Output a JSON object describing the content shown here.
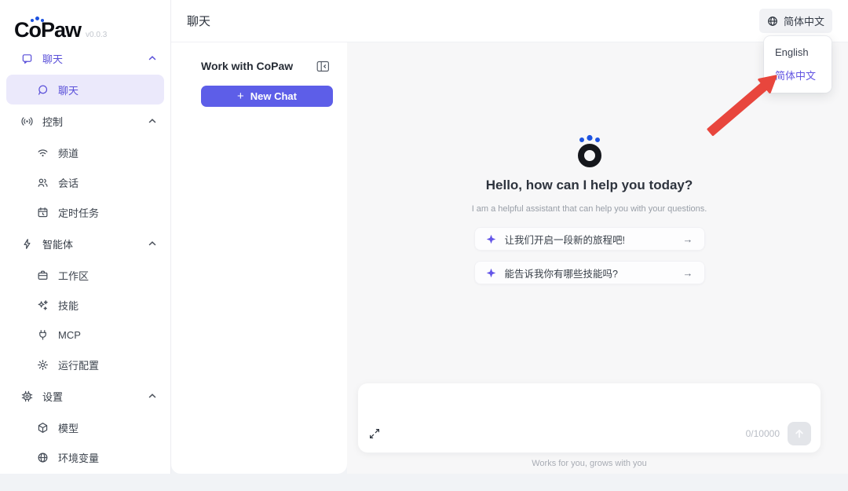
{
  "app": {
    "name": "CoPaw",
    "version": "v0.0.3"
  },
  "colors": {
    "accent": "#5d5ee8",
    "active_item_bg": "#ebe9fb",
    "logo_dot_blue": "#1d53e0",
    "annotation_arrow_red": "#e8463d"
  },
  "icons": {
    "plus": "+",
    "arrow_right": "→"
  },
  "sidebar": {
    "items": [
      {
        "label": "聊天",
        "type": "section",
        "icon": "chat-square"
      },
      {
        "label": "聊天",
        "type": "sub",
        "icon": "chat-bubble",
        "active": true
      },
      {
        "label": "控制",
        "type": "section",
        "icon": "broadcast"
      },
      {
        "label": "频道",
        "type": "sub",
        "icon": "wifi"
      },
      {
        "label": "会话",
        "type": "sub",
        "icon": "users"
      },
      {
        "label": "定时任务",
        "type": "sub",
        "icon": "calendar-clock"
      },
      {
        "label": "智能体",
        "type": "section",
        "icon": "lightning"
      },
      {
        "label": "工作区",
        "type": "sub",
        "icon": "briefcase"
      },
      {
        "label": "技能",
        "type": "sub",
        "icon": "sparkles"
      },
      {
        "label": "MCP",
        "type": "sub",
        "icon": "plug"
      },
      {
        "label": "运行配置",
        "type": "sub",
        "icon": "gear"
      },
      {
        "label": "设置",
        "type": "section",
        "icon": "chip"
      },
      {
        "label": "模型",
        "type": "sub",
        "icon": "cube"
      },
      {
        "label": "环境变量",
        "type": "sub",
        "icon": "globe"
      }
    ]
  },
  "header": {
    "title": "聊天",
    "language_button": "简体中文"
  },
  "language_menu": {
    "items": [
      {
        "label": "English",
        "selected": false
      },
      {
        "label": "简体中文",
        "selected": true
      }
    ]
  },
  "chat_panel": {
    "title": "Work with CoPaw",
    "new_chat_label": "New Chat"
  },
  "main": {
    "greeting": "Hello, how can I help you today?",
    "subtitle": "I am a helpful assistant that can help you with your questions.",
    "suggestions": [
      "让我们开启一段新的旅程吧!",
      "能告诉我你有哪些技能吗?"
    ],
    "composer": {
      "char_count": "0/10000",
      "input_value": ""
    },
    "footer": "Works for you, grows with you"
  }
}
